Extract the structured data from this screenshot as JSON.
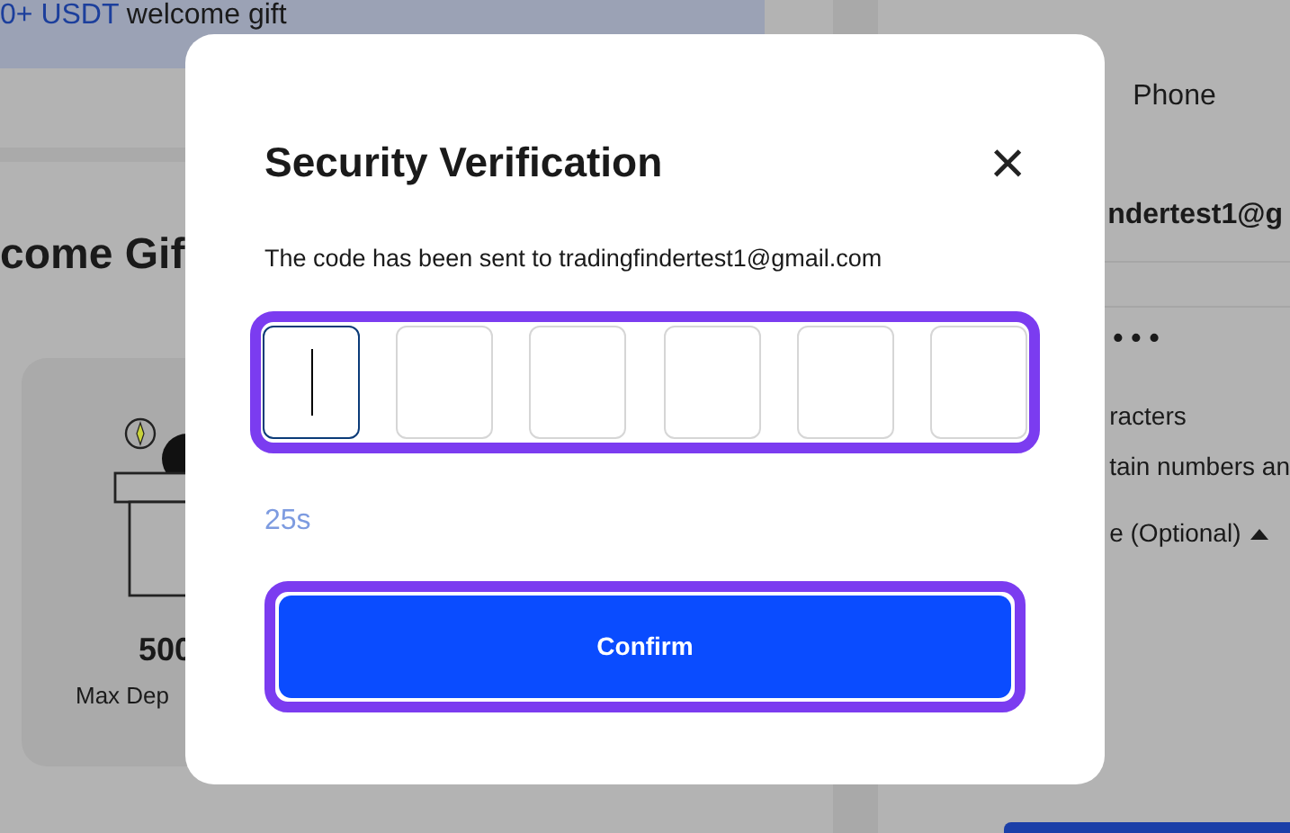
{
  "background_page": {
    "banner": {
      "highlight": "0+ USDT",
      "text": "welcome gift"
    },
    "heading": "come Gif",
    "gift_card": {
      "amount": "500",
      "label": "Max Dep"
    },
    "right_panel": {
      "tab": "Phone",
      "email": "ndertest1@g",
      "password_mask": "• • •",
      "hints": [
        "racters",
        "tain numbers an"
      ],
      "optional_toggle": {
        "label": "e (Optional)",
        "expanded": true
      }
    }
  },
  "dialog": {
    "title": "Security Verification",
    "close": "×",
    "message": "The code has been sent to tradingfindertest1@gmail.com",
    "code_row": {
      "highlighted": true,
      "boxes": [
        {
          "focused": true
        },
        {
          "focused": false
        },
        {
          "focused": false
        },
        {
          "focused": false
        },
        {
          "focused": false
        },
        {
          "focused": false
        }
      ]
    },
    "countdown": "25s",
    "confirm": {
      "label": "Confirm",
      "highlighted": true
    }
  }
}
